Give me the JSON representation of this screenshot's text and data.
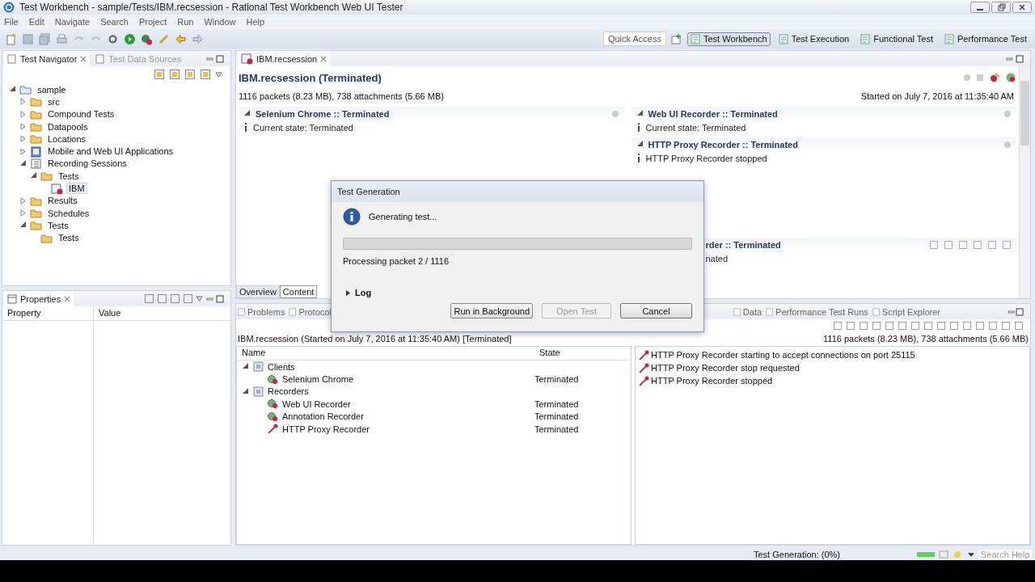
{
  "window": {
    "title": "Test Workbench - sample/Tests/IBM.recsession - Rational Test Workbench Web UI Tester"
  },
  "menu": [
    "File",
    "Edit",
    "Navigate",
    "Search",
    "Project",
    "Run",
    "Window",
    "Help"
  ],
  "toolbar": {
    "quick_access": "Quick Access",
    "perspectives": [
      {
        "label": "Test Workbench",
        "selected": true
      },
      {
        "label": "Test Execution",
        "selected": false
      },
      {
        "label": "Functional Test",
        "selected": false
      },
      {
        "label": "Performance Test",
        "selected": false
      }
    ]
  },
  "navigator": {
    "tabs": [
      {
        "label": "Test Navigator",
        "selected": true
      },
      {
        "label": "Test Data Sources",
        "selected": false
      }
    ],
    "tree": [
      {
        "label": "sample",
        "kind": "project",
        "expanded": true,
        "selected": false,
        "children": [
          {
            "label": "src",
            "kind": "folder",
            "expanded": false,
            "selected": false
          },
          {
            "label": "Compound Tests",
            "kind": "folder",
            "expanded": false,
            "selected": false
          },
          {
            "label": "Datapools",
            "kind": "folder",
            "expanded": false,
            "selected": false
          },
          {
            "label": "Locations",
            "kind": "folder",
            "expanded": false,
            "selected": false
          },
          {
            "label": "Mobile and Web UI Applications",
            "kind": "device",
            "expanded": false,
            "selected": false
          },
          {
            "label": "Recording Sessions",
            "kind": "sessions",
            "expanded": true,
            "selected": false,
            "children": [
              {
                "label": "Tests",
                "kind": "folder",
                "expanded": true,
                "selected": false,
                "children": [
                  {
                    "label": "IBM",
                    "kind": "session",
                    "selected": true
                  }
                ]
              }
            ]
          },
          {
            "label": "Results",
            "kind": "folder",
            "expanded": false,
            "selected": false
          },
          {
            "label": "Schedules",
            "kind": "folder",
            "expanded": false,
            "selected": false
          },
          {
            "label": "Tests",
            "kind": "folder",
            "expanded": true,
            "selected": false,
            "children": [
              {
                "label": "Tests",
                "kind": "folder",
                "selected": false
              }
            ]
          }
        ]
      }
    ]
  },
  "properties": {
    "title": "Properties",
    "columns": [
      "Property",
      "Value"
    ]
  },
  "editor": {
    "tab": "IBM.recsession",
    "heading": "IBM.recsession (Terminated)",
    "summary": "1116 packets (8.23 MB), 738 attachments (5.66 MB)",
    "started": "Started on July 7, 2016 at 11:35:40 AM",
    "left_sections": [
      {
        "kind": "full",
        "title": "Selenium Chrome :: Terminated",
        "expanded": true,
        "lines": [
          "Current state: Terminated"
        ]
      }
    ],
    "right_sections": [
      {
        "kind": "full",
        "title": "Web UI Recorder :: Terminated",
        "expanded": true,
        "lines": [
          "Current state: Terminated"
        ]
      },
      {
        "kind": "full",
        "title": "HTTP Proxy Recorder :: Terminated",
        "expanded": true,
        "lines": [
          "HTTP Proxy Recorder stopped"
        ]
      },
      {
        "kind": "covered",
        "title": "rder :: Terminated",
        "lines": [
          "nated"
        ]
      }
    ],
    "page_tabs": [
      {
        "label": "Overview",
        "selected": false
      },
      {
        "label": "Content",
        "selected": true
      }
    ]
  },
  "bottom": {
    "tabs": [
      {
        "label": "Problems",
        "selected": false
      },
      {
        "label": "Protocol",
        "selected": false
      },
      {
        "label": "Data",
        "selected": false
      },
      {
        "label": "Performance Test Runs",
        "selected": false
      },
      {
        "label": "Script Explorer",
        "selected": false
      }
    ],
    "session": "IBM.recsession (Started on July 7, 2016 at 11:35:40 AM) [Terminated]",
    "summary": "1116 packets (8.23 MB), 738 attachments (5.66 MB)",
    "columns": [
      "Name",
      "State"
    ],
    "rows": [
      {
        "name": "Clients",
        "kind": "group",
        "expanded": true,
        "state": "",
        "children": [
          {
            "name": "Selenium Chrome",
            "kind": "item",
            "state": "Terminated"
          }
        ]
      },
      {
        "name": "Recorders",
        "kind": "group",
        "expanded": true,
        "state": "",
        "children": [
          {
            "name": "Web UI Recorder",
            "kind": "item",
            "state": "Terminated"
          },
          {
            "name": "Annotation Recorder",
            "kind": "item",
            "state": "Terminated"
          },
          {
            "name": "HTTP Proxy Recorder",
            "kind": "proxy",
            "state": "Terminated"
          }
        ]
      }
    ],
    "log": [
      "HTTP Proxy Recorder starting to accept connections on port 25115",
      "HTTP Proxy Recorder stop requested",
      "HTTP Proxy Recorder stopped"
    ]
  },
  "dialog": {
    "title": "Test Generation",
    "message": "Generating test...",
    "level": 0,
    "detail": "Processing packet 2 / 1116",
    "log_toggle": "Log",
    "log_expanded": false,
    "buttons": [
      {
        "label": "Run in Background",
        "disabled": false,
        "default": false
      },
      {
        "label": "Open Test",
        "disabled": true,
        "default": false
      },
      {
        "label": "Cancel",
        "disabled": false,
        "default": true
      }
    ]
  },
  "status": {
    "text": "Test Generation: (0%)",
    "search_placeholder": "Search Help"
  }
}
